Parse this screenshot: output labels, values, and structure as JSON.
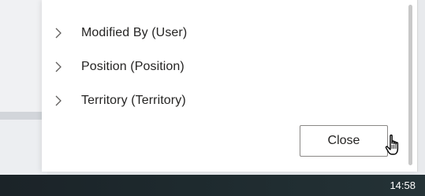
{
  "dialog": {
    "tree_items": [
      {
        "label": "Modified By (User)",
        "icon": "chevron-right-icon"
      },
      {
        "label": "Position (Position)",
        "icon": "chevron-right-icon"
      },
      {
        "label": "Territory (Territory)",
        "icon": "chevron-right-icon"
      }
    ],
    "close_label": "Close"
  },
  "taskbar": {
    "clock": "14:58"
  },
  "colors": {
    "taskbar_bg": "#1e2a2e",
    "button_border": "#8a8886",
    "text": "#252423"
  }
}
